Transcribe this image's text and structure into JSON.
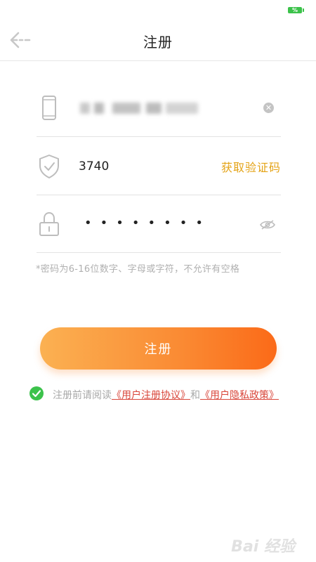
{
  "status_bar": {
    "battery_text": "%"
  },
  "header": {
    "title": "注册"
  },
  "form": {
    "phone": {
      "value": ""
    },
    "code": {
      "value": "3740",
      "get_code_label": "获取验证码"
    },
    "password": {
      "masked_value": "••••••••"
    },
    "hint": "*密码为6-16位数字、字母或字符，不允许有空格"
  },
  "submit": {
    "label": "注册"
  },
  "agreement": {
    "prefix": "注册前请阅读",
    "link_user_agreement": "《用户注册协议》",
    "conjunction": "和",
    "link_privacy_policy": "《用户隐私政策》",
    "checked": true
  },
  "watermark": {
    "text": "Bai 经验"
  },
  "colors": {
    "accent": "#fa8a33",
    "get_code": "#e4a316",
    "link": "#d9463a",
    "check": "#3cc24b"
  },
  "icons": [
    "back-arrow-icon",
    "phone-icon",
    "shield-check-icon",
    "lock-icon",
    "clear-icon",
    "eye-hidden-icon",
    "checkmark-icon"
  ]
}
